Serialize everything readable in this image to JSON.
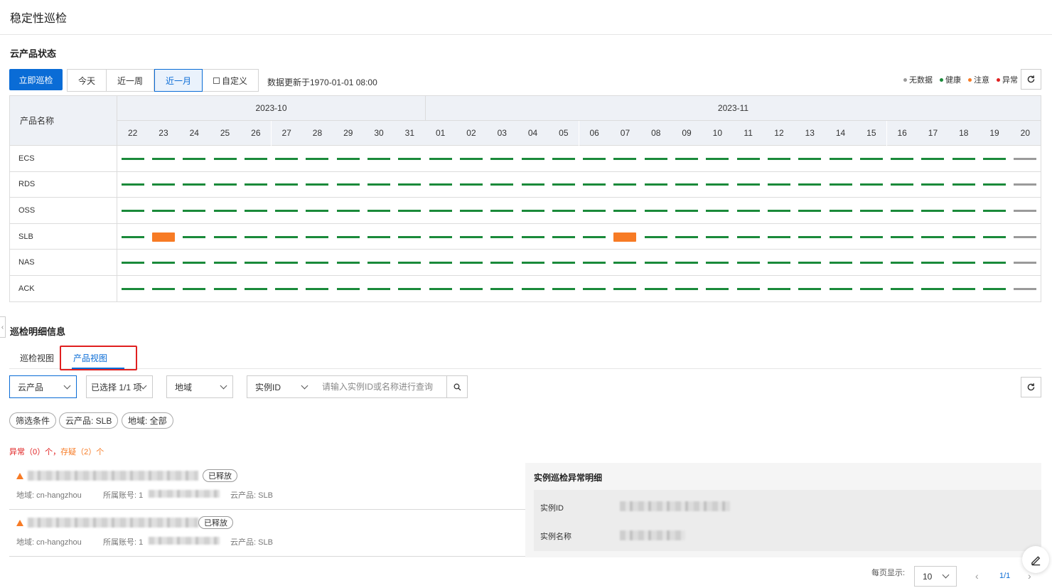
{
  "page": {
    "title": "稳定性巡检"
  },
  "cloud_status": {
    "section_title": "云产品状态",
    "inspect_button": "立即巡检",
    "ranges": [
      {
        "label": "今天",
        "active": false
      },
      {
        "label": "近一周",
        "active": false
      },
      {
        "label": "近一月",
        "active": true
      },
      {
        "label": "自定义",
        "active": false,
        "icon": "calendar-icon"
      }
    ],
    "updated_text": "数据更新于1970-01-01 08:00",
    "legend": [
      {
        "label": "无数据",
        "color": "#9a9a9a"
      },
      {
        "label": "健康",
        "color": "#1a8a3a"
      },
      {
        "label": "注意",
        "color": "#f77b25"
      },
      {
        "label": "异常",
        "color": "#e02020"
      }
    ],
    "table": {
      "name_header": "产品名称",
      "months": [
        {
          "label": "2023-10",
          "days": [
            "22",
            "23",
            "24",
            "25",
            "26",
            "27",
            "28",
            "29",
            "30",
            "31"
          ]
        },
        {
          "label": "2023-11",
          "days": [
            "01",
            "02",
            "03",
            "04",
            "05",
            "06",
            "07",
            "08",
            "09",
            "10",
            "11",
            "12",
            "13",
            "14",
            "15",
            "16",
            "17",
            "18",
            "19",
            "20"
          ]
        }
      ],
      "rows": [
        {
          "name": "ECS",
          "status": [
            "h",
            "h",
            "h",
            "h",
            "h",
            "h",
            "h",
            "h",
            "h",
            "h",
            "h",
            "h",
            "h",
            "h",
            "h",
            "h",
            "h",
            "h",
            "h",
            "h",
            "h",
            "h",
            "h",
            "h",
            "h",
            "h",
            "h",
            "h",
            "h",
            "n"
          ]
        },
        {
          "name": "RDS",
          "status": [
            "h",
            "h",
            "h",
            "h",
            "h",
            "h",
            "h",
            "h",
            "h",
            "h",
            "h",
            "h",
            "h",
            "h",
            "h",
            "h",
            "h",
            "h",
            "h",
            "h",
            "h",
            "h",
            "h",
            "h",
            "h",
            "h",
            "h",
            "h",
            "h",
            "n"
          ]
        },
        {
          "name": "OSS",
          "status": [
            "h",
            "h",
            "h",
            "h",
            "h",
            "h",
            "h",
            "h",
            "h",
            "h",
            "h",
            "h",
            "h",
            "h",
            "h",
            "h",
            "h",
            "h",
            "h",
            "h",
            "h",
            "h",
            "h",
            "h",
            "h",
            "h",
            "h",
            "h",
            "h",
            "n"
          ]
        },
        {
          "name": "SLB",
          "status": [
            "h",
            "w",
            "h",
            "h",
            "h",
            "h",
            "h",
            "h",
            "h",
            "h",
            "h",
            "h",
            "h",
            "h",
            "h",
            "h",
            "w",
            "h",
            "h",
            "h",
            "h",
            "h",
            "h",
            "h",
            "h",
            "h",
            "h",
            "h",
            "h",
            "n"
          ]
        },
        {
          "name": "NAS",
          "status": [
            "h",
            "h",
            "h",
            "h",
            "h",
            "h",
            "h",
            "h",
            "h",
            "h",
            "h",
            "h",
            "h",
            "h",
            "h",
            "h",
            "h",
            "h",
            "h",
            "h",
            "h",
            "h",
            "h",
            "h",
            "h",
            "h",
            "h",
            "h",
            "h",
            "n"
          ]
        },
        {
          "name": "ACK",
          "status": [
            "h",
            "h",
            "h",
            "h",
            "h",
            "h",
            "h",
            "h",
            "h",
            "h",
            "h",
            "h",
            "h",
            "h",
            "h",
            "h",
            "h",
            "h",
            "h",
            "h",
            "h",
            "h",
            "h",
            "h",
            "h",
            "h",
            "h",
            "h",
            "h",
            "n"
          ]
        }
      ]
    }
  },
  "detail": {
    "section_title": "巡检明细信息",
    "tabs": [
      {
        "label": "巡检视图",
        "active": false
      },
      {
        "label": "产品视图",
        "active": true
      }
    ],
    "filters": {
      "product_select": "云产品",
      "selected_select": "已选择 1/1 项",
      "region_select": "地域",
      "instance_select": "实例ID",
      "search_placeholder": "请输入实例ID或名称进行查询"
    },
    "chips": [
      "筛选条件",
      "云产品: SLB",
      "地域: 全部"
    ],
    "summary": {
      "abnormal_label": "异常",
      "abnormal_count": "（0）个，",
      "suspect_label": "存疑",
      "suspect_count": "（2）个"
    },
    "items": [
      {
        "badge": "已释放",
        "region": "地域: cn-hangzhou",
        "account": "所属账号: 1",
        "product": "云产品: SLB"
      },
      {
        "badge": "已释放",
        "region": "地域: cn-hangzhou",
        "account": "所属账号: 1",
        "product": "云产品: SLB"
      }
    ],
    "instance_detail": {
      "title": "实例巡检异常明细",
      "id_label": "实例ID",
      "name_label": "实例名称"
    },
    "pagination": {
      "per_page_label": "每页显示:",
      "per_page_value": "10",
      "page_text": "1/1"
    }
  }
}
